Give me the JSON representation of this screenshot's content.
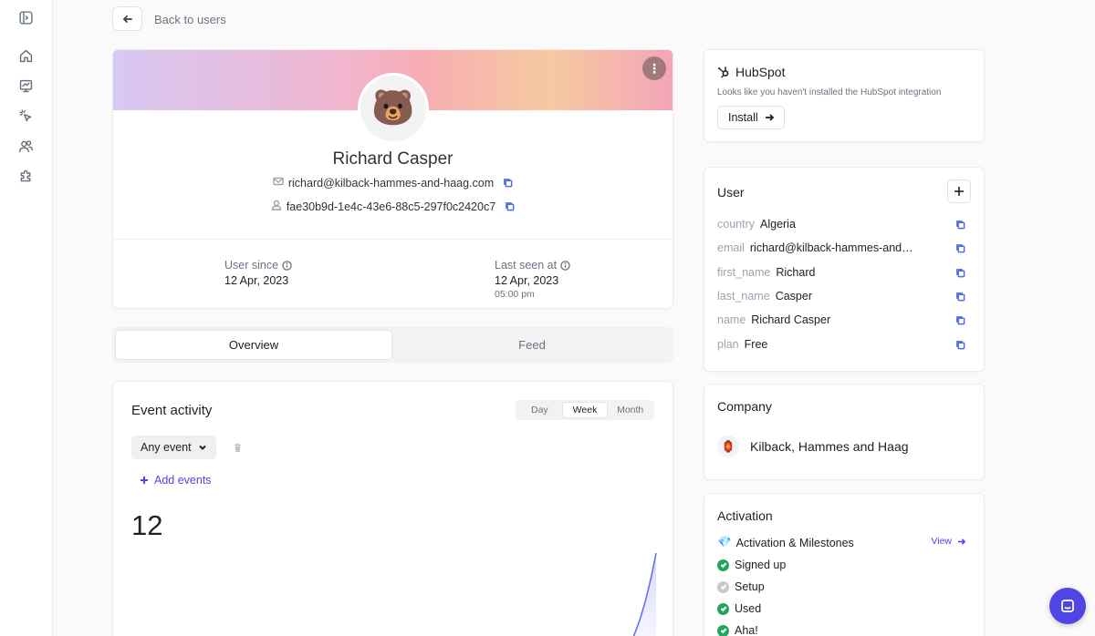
{
  "back_label": "Back to users",
  "profile": {
    "name": "Richard Casper",
    "email": "richard@kilback-hammes-and-haag.com",
    "user_id": "fae30b9d-1e4c-43e6-88c5-297f0c2420c7",
    "avatar_emoji": "🐻",
    "user_since_label": "User since",
    "user_since_value": "12 Apr, 2023",
    "last_seen_label": "Last seen at",
    "last_seen_date": "12 Apr, 2023",
    "last_seen_time": "05:00 pm"
  },
  "tabs": [
    "Overview",
    "Feed"
  ],
  "activity": {
    "title": "Event activity",
    "periods": [
      "Day",
      "Week",
      "Month"
    ],
    "selected_period": "Week",
    "event_filter": "Any event",
    "add_events": "Add events",
    "count": "12"
  },
  "hubspot": {
    "title": "HubSpot",
    "description": "Looks like you haven't installed the HubSpot integration",
    "install": "Install"
  },
  "user": {
    "title": "User",
    "attributes": [
      {
        "key": "country",
        "value": "Algeria"
      },
      {
        "key": "email",
        "value": "richard@kilback-hammes-and-haag.com"
      },
      {
        "key": "first_name",
        "value": "Richard"
      },
      {
        "key": "last_name",
        "value": "Casper"
      },
      {
        "key": "name",
        "value": "Richard Casper"
      },
      {
        "key": "plan",
        "value": "Free"
      }
    ]
  },
  "company": {
    "title": "Company",
    "name": "Kilback, Hammes and Haag"
  },
  "activation": {
    "title": "Activation",
    "heading": "Activation & Milestones",
    "view": "View",
    "milestones": [
      {
        "label": "Signed up",
        "done": true
      },
      {
        "label": "Setup",
        "done": false
      },
      {
        "label": "Used",
        "done": true
      },
      {
        "label": "Aha!",
        "done": true
      }
    ]
  },
  "colors": {
    "accent": "#4f46e5",
    "success": "#22a55a",
    "pending": "#c9c9c9"
  }
}
